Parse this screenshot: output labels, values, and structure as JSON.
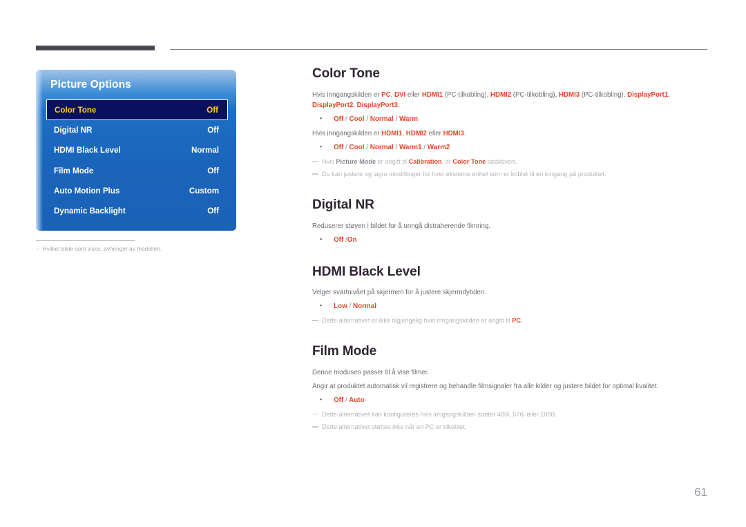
{
  "page": {
    "number": "61"
  },
  "osd": {
    "title": "Picture Options",
    "rows": [
      {
        "label": "Color Tone",
        "value": "Off",
        "selected": true
      },
      {
        "label": "Digital NR",
        "value": "Off",
        "selected": false
      },
      {
        "label": "HDMI Black Level",
        "value": "Normal",
        "selected": false
      },
      {
        "label": "Film Mode",
        "value": "Off",
        "selected": false
      },
      {
        "label": "Auto Motion Plus",
        "value": "Custom",
        "selected": false
      },
      {
        "label": "Dynamic Backlight",
        "value": "Off",
        "selected": false
      }
    ],
    "footnote_dash": "–",
    "footnote": "Hvilket bilde som vises, avhenger av modellen."
  },
  "sections": {
    "color_tone": {
      "heading": "Color Tone",
      "para1_a": "Hvis inngangskilden er ",
      "para1_b": "PC",
      "para1_c": ", ",
      "para1_d": "DVI",
      "para1_e": " eller ",
      "para1_f": "HDMI1",
      "para1_g": " (PC-tilkobling), ",
      "para1_h": "HDMI2",
      "para1_i": " (PC-tilkobling), ",
      "para1_j": "HDMI3",
      "para1_k": " (PC-tilkobling), ",
      "para1_l": "DisplayPort1",
      "para1_m": ", ",
      "para1_n": "DisplayPort2",
      "para1_o": ", ",
      "para1_p": "DisplayPort3",
      "para1_q": ".",
      "option1": "Off / Cool / Normal / Warm",
      "para2_a": "Hvis inngangskilden er ",
      "para2_b": "HDMI1",
      "para2_c": ", ",
      "para2_d": "HDMI2",
      "para2_e": " eller ",
      "para2_f": "HDMI3",
      "para2_g": ".",
      "option2": "Off / Cool / Normal / Warm1 / Warm2",
      "note1_a": "Hvis ",
      "note1_b": "Picture Mode",
      "note1_c": " er angitt til ",
      "note1_d": "Calibration",
      "note1_e": ", er ",
      "note1_f": "Color Tone",
      "note1_g": " deaktivert.",
      "note2": "Du kan justere og lagre innstillinger for hver eksterne enhet som er koblet til en inngang på produktet."
    },
    "digital_nr": {
      "heading": "Digital NR",
      "para1": "Reduserer støyen i bildet for å unngå distraherende flimring.",
      "option1": "Off /On"
    },
    "hdmi_black_level": {
      "heading": "HDMI Black Level",
      "para1": "Velger svartnivået på skjermen for å justere skjermdybden.",
      "option1": "Low / Normal",
      "note1_a": "Dette alternativet er ikke tilgjengelig hvis inngangskilden er angitt til ",
      "note1_b": "PC",
      "note1_c": "."
    },
    "film_mode": {
      "heading": "Film Mode",
      "para1": "Denne modusen passer til å vise filmer.",
      "para2": "Angir at produktet automatisk vil registrere og behandle filmsignaler fra alle kilder og justere bildet for optimal kvalitet.",
      "option1": "Off / Auto",
      "note1": "Dette alternativet kan konfigureres hvis inngangskilden støtter 480i, 576i eller 1080i.",
      "note2": "Dette alternativet støttes ikke når en PC er tilkoblet."
    }
  },
  "colors": {
    "accent": "#e8442a",
    "heading": "#2e2430",
    "body": "#6f6b75",
    "panel_blue": "#1a64bb",
    "selected_bg": "#0a1060",
    "selected_text": "#ffd400"
  }
}
